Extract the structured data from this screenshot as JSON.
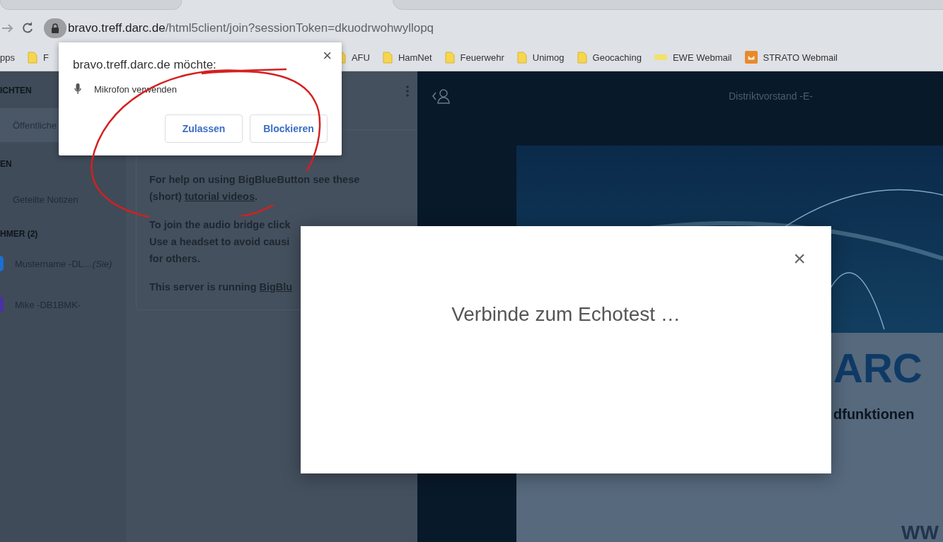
{
  "address_bar": {
    "host": "bravo.treff.darc.de",
    "path": "/html5client/join?sessionToken=dkuodrwohwyllopq"
  },
  "bookmarks": [
    {
      "label": "pps",
      "kind": "plain"
    },
    {
      "label": "F",
      "kind": "folder"
    },
    {
      "label": "AFU",
      "kind": "folder"
    },
    {
      "label": "HamNet",
      "kind": "folder"
    },
    {
      "label": "Feuerwehr",
      "kind": "folder"
    },
    {
      "label": "Unimog",
      "kind": "folder"
    },
    {
      "label": "Geocaching",
      "kind": "folder"
    },
    {
      "label": "EWE Webmail",
      "kind": "ewe"
    },
    {
      "label": "STRATO Webmail",
      "kind": "mail"
    }
  ],
  "permission_popup": {
    "title": "bravo.treff.darc.de möchte:",
    "close": "×",
    "request": "Mikrofon verwenden",
    "buttons": [
      "Zulassen",
      "Blockieren"
    ]
  },
  "sidebar": {
    "messages_heading": "ICHTEN",
    "public_chat": {
      "label": "Öffentliche",
      "selected": true
    },
    "notes_heading": "EN",
    "shared_notes": "Geteilte Notizen",
    "users_heading": "HMER (2)",
    "users": [
      {
        "name": "Mustername -DL…*(Sie)*",
        "color": "#1b6fd0"
      },
      {
        "name": "Mike -DB1BMK-",
        "color": "#4b2fa8"
      }
    ]
  },
  "chat": {
    "paragraphs": [
      {
        "text": "For help on using BigBlueButton see these (short) ",
        "link": "tutorial videos",
        "after": "."
      },
      {
        "lines": [
          "To join the audio bridge click",
          "Use a headset to avoid causi",
          "for others."
        ]
      },
      {
        "text": "This server is running ",
        "link": "BigBlu"
      }
    ]
  },
  "presentation": {
    "title": "Distriktvorstand -E-",
    "slide_big": "ARC",
    "slide_sub": "dfunktionen",
    "slide_url": "WW"
  },
  "modal": {
    "message": "Verbinde zum Echotest …",
    "close": "×"
  }
}
